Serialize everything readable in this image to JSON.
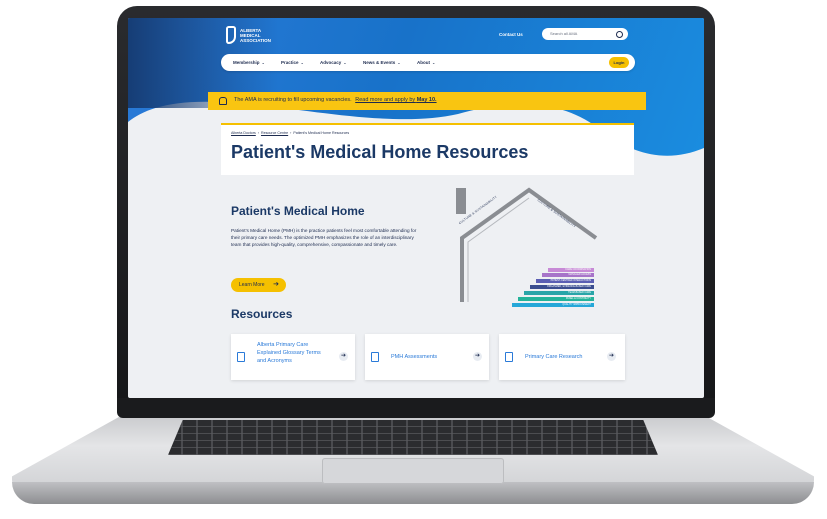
{
  "logo": {
    "text": "ALBERTA MEDICAL ASSOCIATION"
  },
  "header": {
    "contact": "Contact Us",
    "search_placeholder": "Search all AMA",
    "login": "Login"
  },
  "nav": {
    "items": [
      {
        "label": "Membership"
      },
      {
        "label": "Practice"
      },
      {
        "label": "Advocacy"
      },
      {
        "label": "News & Events"
      },
      {
        "label": "About"
      }
    ]
  },
  "alert": {
    "message": "The AMA is recruiting to fill upcoming vacancies.",
    "link": "Read more and apply by",
    "link_bold": "May 10."
  },
  "breadcrumb": {
    "items": [
      "Alberta Doctors",
      "Resource Centre",
      "Patient's Medical Home Resources"
    ],
    "sep": "›"
  },
  "page": {
    "title": "Patient's Medical Home Resources",
    "section_title": "Patient's Medical Home",
    "section_body": "Patient's Medical Home (PMH) is the practice patients feel most comfortable attending for their primary care needs. The optimized PMH emphasizes the role of an interdisciplinary team that provides high-quality, comprehensive, compassionate and timely care.",
    "learn_more": "Learn More",
    "resources_title": "Resources"
  },
  "diagram": {
    "roof_left": "CULTURE & SUSTAINABILITY",
    "roof_right": "CULTURE & SUSTAINABILITY",
    "steps": [
      {
        "label": "CARE COORDINATION",
        "color": "#c78ad6"
      },
      {
        "label": "MANAGED ACCESS",
        "color": "#a774c9"
      },
      {
        "label": "PATIENT-CENTRED INTERACTIONS",
        "color": "#5b5fb3"
      },
      {
        "label": "ORGANIZED, EVIDENCE-BASED CARE",
        "color": "#3a4d8f"
      },
      {
        "label": "TEAM-BASED CARE",
        "color": "#2aa5a8"
      },
      {
        "label": "PANEL & CONTINUITY",
        "color": "#25b39a"
      },
      {
        "label": "QUALITY IMPROVEMENT",
        "color": "#25a7d8"
      }
    ]
  },
  "resources": [
    {
      "label": "Alberta Primary Care Explained Glossary Terms and Acronyms"
    },
    {
      "label": "PMH Assessments"
    },
    {
      "label": "Primary Care Research"
    }
  ],
  "colors": {
    "brand_blue": "#1872c9",
    "navy": "#1b3966",
    "accent_yellow": "#f5c000"
  }
}
